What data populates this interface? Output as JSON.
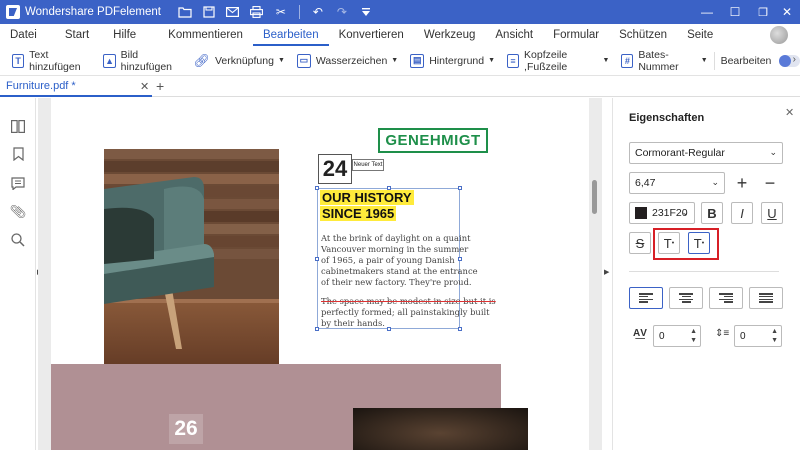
{
  "titlebar": {
    "app_title": "Wondershare PDFelement"
  },
  "menu": [
    "Datei",
    "Start",
    "Hilfe",
    "Kommentieren",
    "Bearbeiten",
    "Konvertieren",
    "Werkzeug",
    "Ansicht",
    "Formular",
    "Schützen",
    "Seite"
  ],
  "toolbar": {
    "text_add": "Text hinzufügen",
    "image_add": "Bild hinzufügen",
    "link": "Verknüpfung",
    "watermark": "Wasserzeichen",
    "background": "Hintergrund",
    "header_footer": "Kopfzeile ,Fußzeile",
    "bates": "Bates-Nummer",
    "edit": "Bearbeiten"
  },
  "tab": {
    "name": "Furniture.pdf *"
  },
  "document": {
    "stamp": "GENEHMIGT",
    "page_number_top": "24",
    "new_text_label": "Neuer Text",
    "headline_1": "OUR HISTORY",
    "headline_2": "SINCE 1965",
    "body_lines": [
      "At the brink of daylight on a quaint",
      "Vancouver morning in the summer",
      "of 1965, a pair of young Danish",
      "cabinetmakers stand at the entrance",
      "of their new factory. They're proud."
    ],
    "strike_line": "The space may be modest in size but it is",
    "body_lines_2": [
      "perfectly formed; all painstakingly built",
      "by their hands."
    ],
    "page_number_bottom": "26"
  },
  "properties": {
    "title": "Eigenschaften",
    "font": "Cormorant-Regular",
    "font_size": "6,47",
    "color_hex": "231F20",
    "color": "#231F20",
    "char_spacing": "0",
    "line_spacing": "0"
  },
  "colors": {
    "titlebar": "#3b62c6",
    "accent": "#2b5fc9",
    "stamp_green": "#1e8f4a",
    "highlight_yellow": "#ffeb3b",
    "highlight_box_red": "#d71f26"
  }
}
